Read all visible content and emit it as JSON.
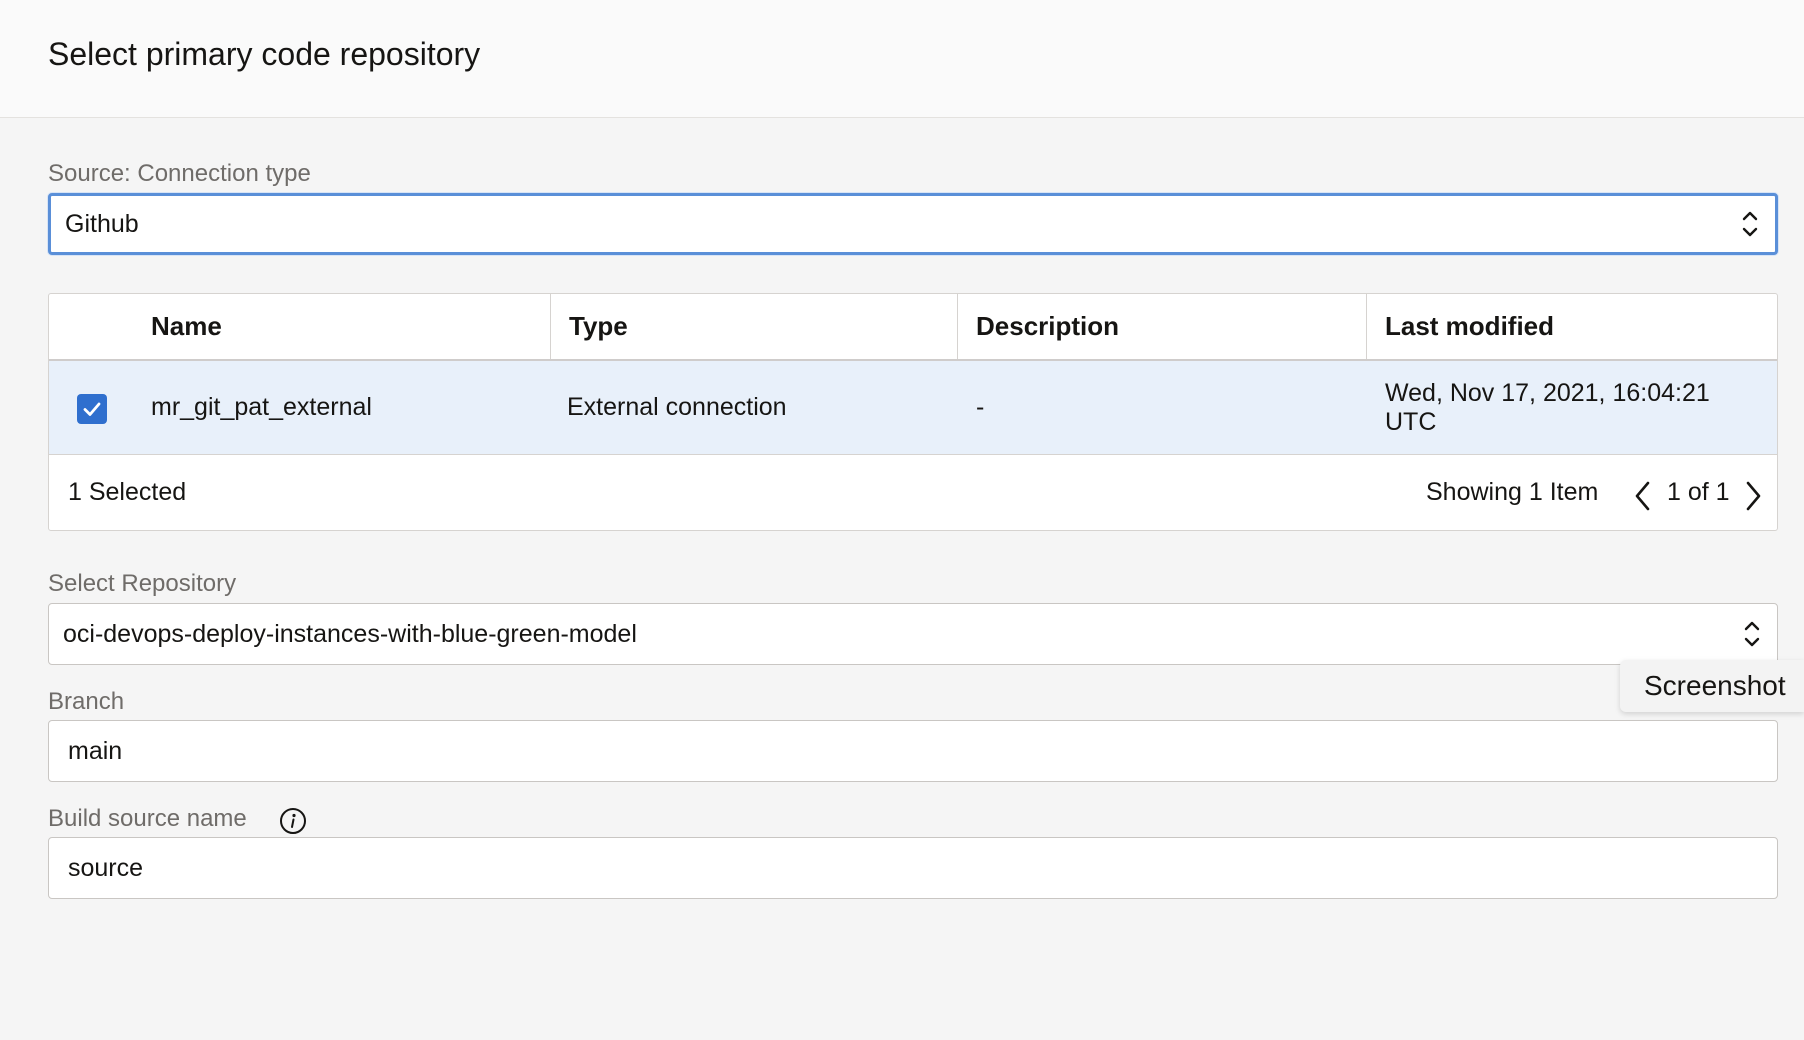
{
  "header": {
    "title": "Select primary code repository"
  },
  "connection_type": {
    "label": "Source: Connection type",
    "value": "Github"
  },
  "table": {
    "columns": [
      "Name",
      "Type",
      "Description",
      "Last modified"
    ],
    "rows": [
      {
        "selected": true,
        "name": "mr_git_pat_external",
        "type": "External connection",
        "description": "-",
        "last_modified": "Wed, Nov 17, 2021, 16:04:21 UTC"
      }
    ],
    "footer": {
      "selected_count": "1 Selected",
      "showing": "Showing 1 Item",
      "page": "1 of 1"
    }
  },
  "repository": {
    "label": "Select Repository",
    "value": "oci-devops-deploy-instances-with-blue-green-model"
  },
  "branch": {
    "label": "Branch",
    "value": "main"
  },
  "build_source": {
    "label": "Build source name",
    "value": "source"
  },
  "tooltip": {
    "text": "Screenshot"
  },
  "colors": {
    "accent": "#2f6fce",
    "selected_row": "#e8f0fa",
    "focus_border": "#5a8fd8"
  },
  "icons": {
    "select_arrows": "updown-chevron-icon",
    "checkbox": "check-icon",
    "pager_prev": "chevron-left-icon",
    "pager_next": "chevron-right-icon",
    "info": "info-icon"
  }
}
